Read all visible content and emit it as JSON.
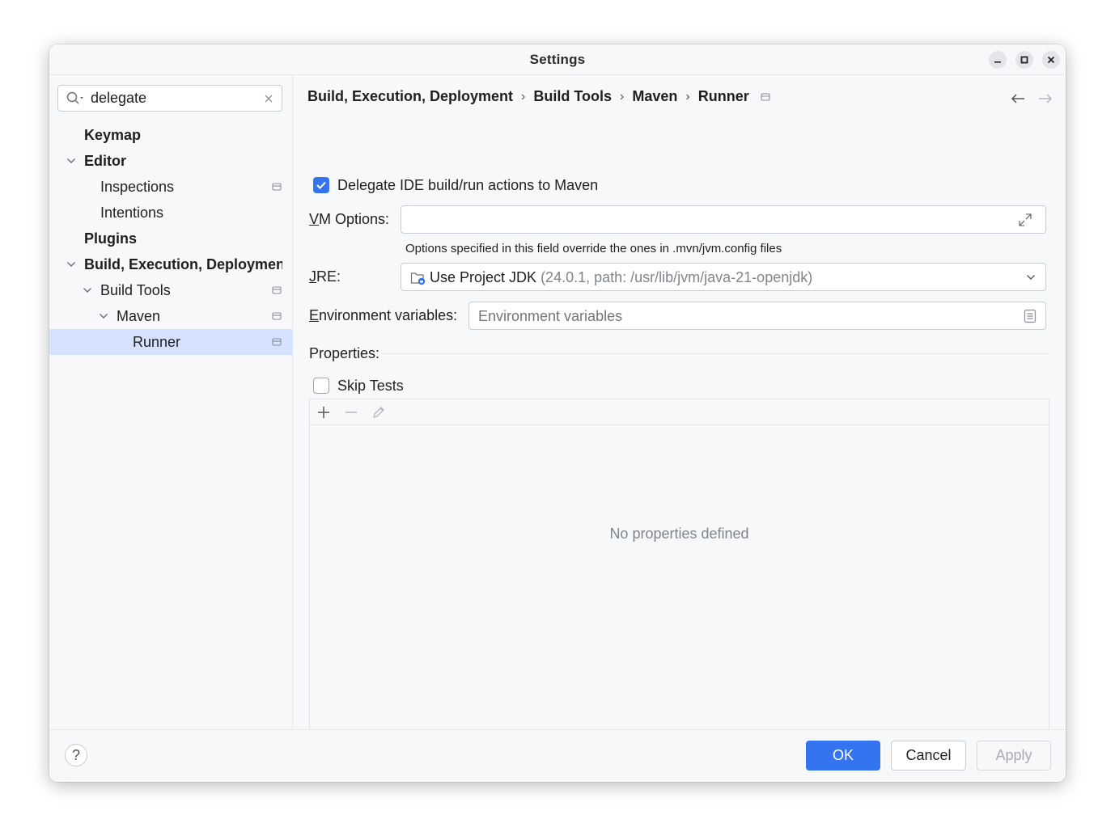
{
  "window": {
    "title": "Settings"
  },
  "sidebar": {
    "search": {
      "value": "delegate",
      "placeholder": ""
    },
    "items": [
      {
        "label": "Keymap"
      },
      {
        "label": "Editor"
      },
      {
        "label": "Inspections"
      },
      {
        "label": "Intentions"
      },
      {
        "label": "Plugins"
      },
      {
        "label": "Build, Execution, Deployment"
      },
      {
        "label": "Build Tools"
      },
      {
        "label": "Maven"
      },
      {
        "label": "Runner"
      }
    ]
  },
  "breadcrumb": {
    "items": [
      "Build, Execution, Deployment",
      "Build Tools",
      "Maven",
      "Runner"
    ],
    "separator": "›"
  },
  "form": {
    "delegate": {
      "label": "Delegate IDE build/run actions to Maven",
      "checked": true
    },
    "vm_options": {
      "label_mnemonic": "V",
      "label_rest": "M Options:",
      "value": "",
      "hint": "Options specified in this field override the ones in .mvn/jvm.config files"
    },
    "jre": {
      "label_mnemonic": "J",
      "label_rest": "RE:",
      "selected_main": "Use Project JDK",
      "selected_detail": "(24.0.1, path: /usr/lib/jvm/java-21-openjdk)"
    },
    "env": {
      "label_mnemonic": "E",
      "label_rest": "nvironment variables:",
      "value": "",
      "placeholder": "Environment variables"
    },
    "properties": {
      "label": "Properties:",
      "empty_text": "No properties defined"
    },
    "skip_tests": {
      "label": "Skip Tests",
      "checked": false
    }
  },
  "footer": {
    "help": "?",
    "ok": "OK",
    "cancel": "Cancel",
    "apply": "Apply"
  },
  "colors": {
    "accent": "#3574f0",
    "selection": "#d4e2ff"
  }
}
